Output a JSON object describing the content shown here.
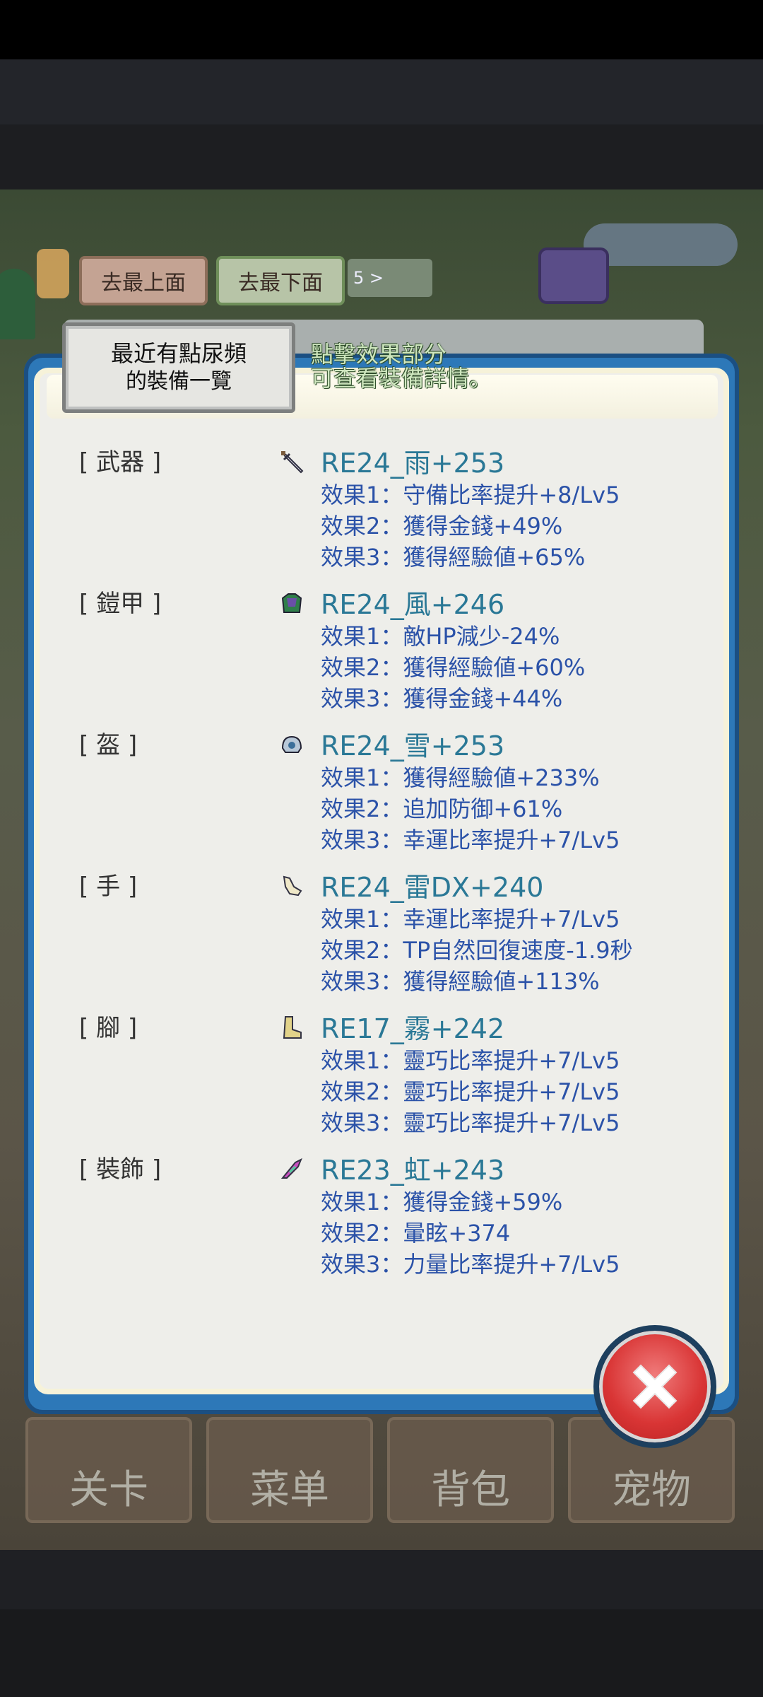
{
  "hud": {
    "go_top": "去最上面",
    "go_bottom": "去最下面",
    "page_indicator": "5 >"
  },
  "dialog": {
    "tab_line1": "最近有點尿頻",
    "tab_line2": "的裝備一覽",
    "hint_line1": "點擊效果部分",
    "hint_line2": "可查看裝備詳情。"
  },
  "slots": [
    {
      "label": "[ 武器 ]",
      "icon": "sword-icon",
      "name": "RE24_雨+253",
      "effects": [
        "效果1：守備比率提升+8/Lv5",
        "效果2：獲得金錢+49%",
        "效果3：獲得經驗値+65%"
      ]
    },
    {
      "label": "[ 鎧甲 ]",
      "icon": "armor-icon",
      "name": "RE24_風+246",
      "effects": [
        "效果1：敵HP減少-24%",
        "效果2：獲得經驗値+60%",
        "效果3：獲得金錢+44%"
      ]
    },
    {
      "label": "[ 盔 ]",
      "icon": "helmet-icon",
      "name": "RE24_雪+253",
      "effects": [
        "效果1：獲得經驗値+233%",
        "效果2：追加防御+61%",
        "效果3：幸運比率提升+7/Lv5"
      ]
    },
    {
      "label": "[ 手 ]",
      "icon": "glove-icon",
      "name": "RE24_雷DX+240",
      "effects": [
        "效果1：幸運比率提升+7/Lv5",
        "效果2：TP自然回復速度-1.9秒",
        "效果3：獲得經驗値+113%"
      ]
    },
    {
      "label": "[ 腳 ]",
      "icon": "boot-icon",
      "name": "RE17_霧+242",
      "effects": [
        "效果1：靈巧比率提升+7/Lv5",
        "效果2：靈巧比率提升+7/Lv5",
        "效果3：靈巧比率提升+7/Lv5"
      ]
    },
    {
      "label": "[ 裝飾 ]",
      "icon": "feather-icon",
      "name": "RE23_虹+243",
      "effects": [
        "效果1：獲得金錢+59%",
        "效果2：暈眩+374",
        "效果3：力量比率提升+7/Lv5"
      ]
    }
  ],
  "menu": {
    "stage": "关卡",
    "list": "菜单",
    "bag": "背包",
    "pet": "宠物"
  },
  "colors": {
    "dialog_border": "#2d78b8",
    "item_name": "#2a7896",
    "effect_text": "#2b52a8",
    "close_red": "#d93535"
  }
}
